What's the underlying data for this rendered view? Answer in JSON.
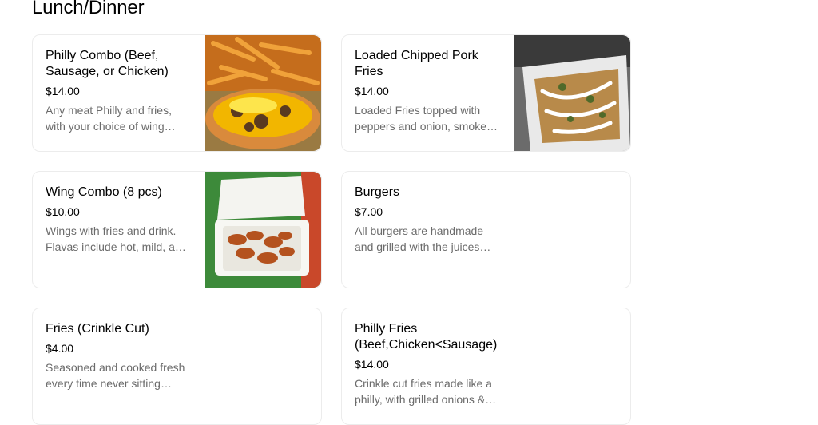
{
  "section": {
    "title": "Lunch/Dinner"
  },
  "items": [
    {
      "name": "Philly Combo (Beef, Sausage, or Chicken)",
      "price": "$14.00",
      "description": "Any meat Philly and fries, with your choice of wing sauce.",
      "image_icon": "philly-combo-photo-icon"
    },
    {
      "name": "Loaded Chipped Pork Fries",
      "price": "$14.00",
      "description": "Loaded Fries topped with peppers and onion, smoked pork and sauce.",
      "image_icon": "loaded-fries-photo-icon"
    },
    {
      "name": "Wing Combo (8 pcs)",
      "price": "$10.00",
      "description": "Wings with fries and drink. Flavas include hot, mild, and more.",
      "image_icon": "wings-photo-icon"
    },
    {
      "name": "Burgers",
      "price": "$7.00",
      "description": "All burgers are handmade and grilled with the juices locked in.",
      "image_icon": ""
    },
    {
      "name": "Fries (Crinkle Cut)",
      "price": "$4.00",
      "description": "Seasoned and cooked fresh every time never sitting around.",
      "image_icon": ""
    },
    {
      "name": "Philly Fries (Beef,Chicken<Sausage)",
      "price": "$14.00",
      "description": "Crinkle cut fries made like a philly, with grilled onions & peppers.",
      "image_icon": ""
    }
  ]
}
